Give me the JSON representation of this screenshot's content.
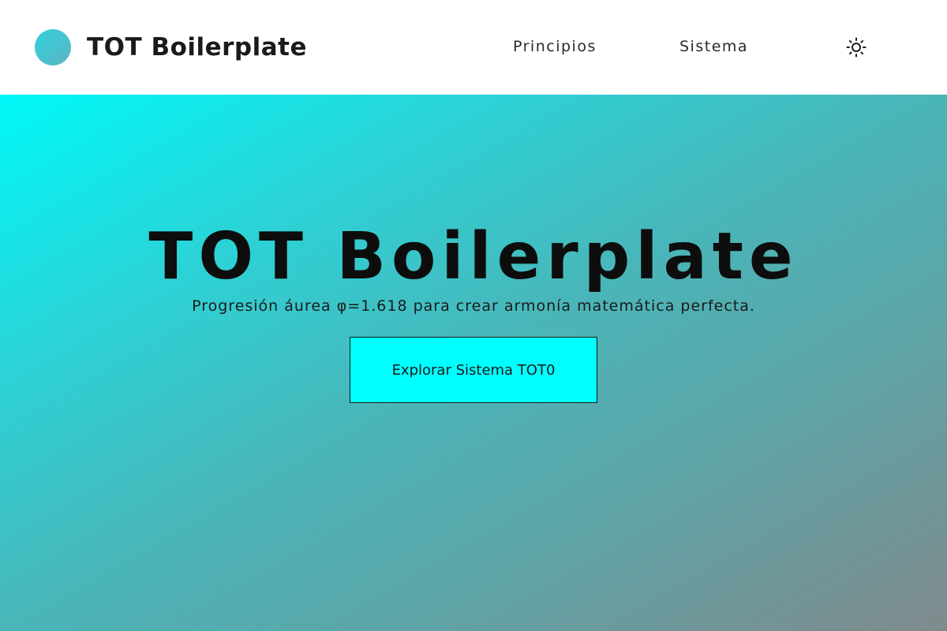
{
  "header": {
    "brand": "TOT Boilerplate",
    "logo_icon": "circle-logo-icon",
    "nav": [
      {
        "label": "Principios"
      },
      {
        "label": "Sistema"
      }
    ],
    "theme_icon": "sun-icon"
  },
  "hero": {
    "title": "TOT Boilerplate",
    "subtitle": "Progresión áurea φ=1.618 para crear armonía matemática perfecta.",
    "cta_label": "Explorar Sistema TOT0"
  },
  "colors": {
    "cta_background": "#00ffff",
    "gradient_start": "#00f8f8",
    "gradient_end": "#808a8c"
  }
}
